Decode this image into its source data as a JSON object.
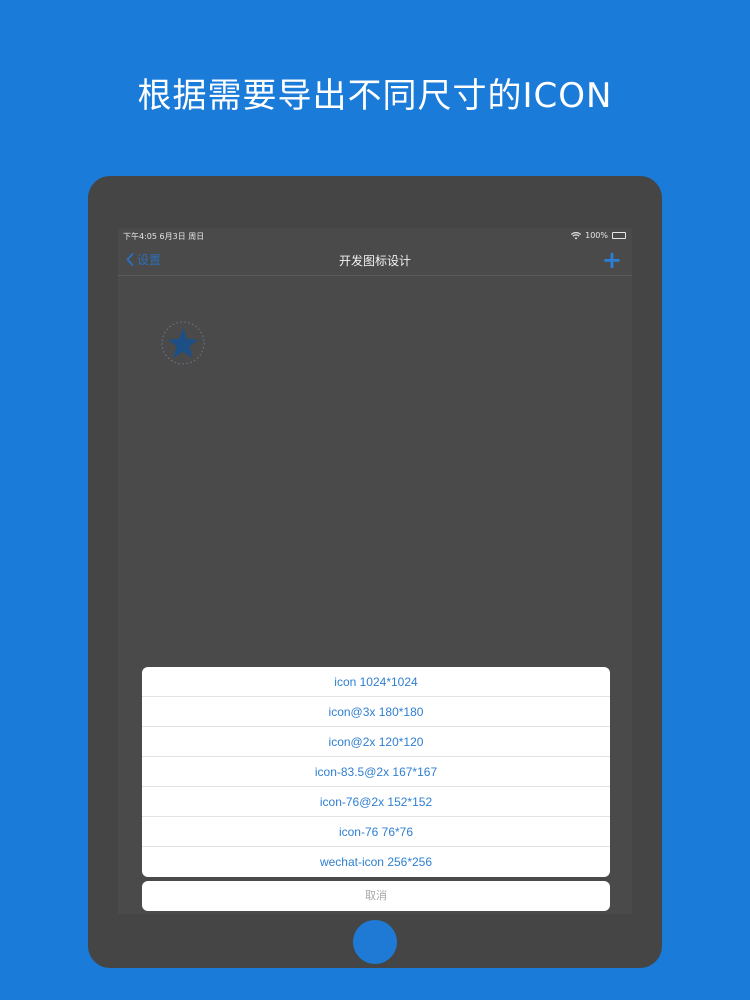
{
  "promo": {
    "title": "根据需要导出不同尺寸的ICON"
  },
  "status_bar": {
    "time_date": "下午4:05 6月3日 周日",
    "battery": "100%"
  },
  "nav": {
    "back_label": "设置",
    "title": "开发图标设计",
    "add_label": "+"
  },
  "action_sheet": {
    "items": [
      "icon 1024*1024",
      "icon@3x 180*180",
      "icon@2x 120*120",
      "icon-83.5@2x 167*167",
      "icon-76@2x 152*152",
      "icon-76 76*76",
      "wechat-icon 256*256"
    ],
    "cancel_label": "取消"
  },
  "colors": {
    "background": "#1b7bd8",
    "accent": "#2f7fd0",
    "device": "#454545",
    "screen": "#4a4a4b"
  }
}
